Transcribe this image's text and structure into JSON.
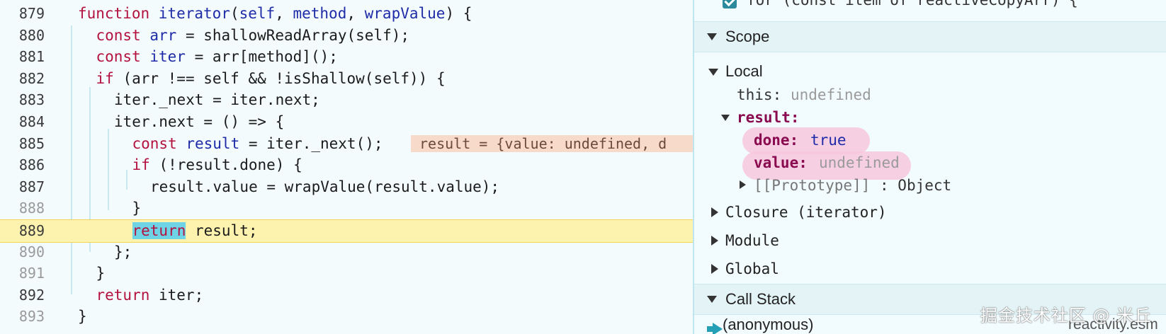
{
  "editor": {
    "lines": [
      {
        "num": "879",
        "t": [
          {
            "c": "kw",
            "v": "function "
          },
          {
            "c": "fn",
            "v": "iterator"
          },
          {
            "c": "",
            "v": "("
          },
          {
            "c": "fn",
            "v": "self"
          },
          {
            "c": "",
            "v": ", "
          },
          {
            "c": "fn",
            "v": "method"
          },
          {
            "c": "",
            "v": ", "
          },
          {
            "c": "fn",
            "v": "wrapValue"
          },
          {
            "c": "",
            "v": ") {"
          }
        ]
      },
      {
        "num": "880",
        "t": [
          {
            "c": "kw",
            "v": "const "
          },
          {
            "c": "fn",
            "v": "arr"
          },
          {
            "c": "",
            "v": " = shallowReadArray(self);"
          }
        ]
      },
      {
        "num": "881",
        "t": [
          {
            "c": "kw",
            "v": "const "
          },
          {
            "c": "fn",
            "v": "iter"
          },
          {
            "c": "",
            "v": " = arr[method]();"
          }
        ]
      },
      {
        "num": "882",
        "t": [
          {
            "c": "kw",
            "v": "if"
          },
          {
            "c": "",
            "v": " (arr !== self && !isShallow(self)) {"
          }
        ]
      },
      {
        "num": "883",
        "t": [
          {
            "c": "",
            "v": "iter._next = iter.next;"
          }
        ]
      },
      {
        "num": "884",
        "t": [
          {
            "c": "",
            "v": "iter.next = () => {"
          }
        ]
      },
      {
        "num": "885",
        "t": [
          {
            "c": "kw",
            "v": "const "
          },
          {
            "c": "fn",
            "v": "result"
          },
          {
            "c": "",
            "v": " = iter._next();"
          }
        ]
      },
      {
        "num": "886",
        "t": [
          {
            "c": "kw",
            "v": "if"
          },
          {
            "c": "",
            "v": " (!result.done) {"
          }
        ]
      },
      {
        "num": "887",
        "t": [
          {
            "c": "",
            "v": "result.value = wrapValue(result.value);"
          }
        ]
      },
      {
        "num": "888",
        "t": [
          {
            "c": "",
            "v": "}"
          }
        ]
      },
      {
        "num": "889",
        "t": [
          {
            "c": "ret",
            "v": "return"
          },
          {
            "c": "",
            "v": " result;"
          }
        ]
      },
      {
        "num": "890",
        "t": [
          {
            "c": "",
            "v": "};"
          }
        ]
      },
      {
        "num": "891",
        "t": [
          {
            "c": "",
            "v": "}"
          }
        ]
      },
      {
        "num": "892",
        "t": [
          {
            "c": "kw",
            "v": "return"
          },
          {
            "c": "",
            "v": " iter;"
          }
        ]
      },
      {
        "num": "893",
        "t": [
          {
            "c": "",
            "v": "}"
          }
        ]
      }
    ],
    "inline_value": "result = {value: undefined, d"
  },
  "panel": {
    "breakpoint_text": "for (const item of reactiveCopyArr) {",
    "scope_header": "Scope",
    "local_label": "Local",
    "this_key": "this",
    "this_value": "undefined",
    "result_key": "result",
    "done_key": "done",
    "done_value": "true",
    "value_key": "value",
    "value_value": "undefined",
    "prototype_label": "[[Prototype]]",
    "prototype_value": "Object",
    "closure_label": "Closure (iterator)",
    "module_label": "Module",
    "global_label": "Global",
    "callstack_header": "Call Stack",
    "frame_name": "(anonymous)",
    "frame_file": "reactivity.esm"
  },
  "watermark": "掘金技术社区 @ 米丘",
  "colors": {
    "keyword": "#b3123f",
    "identifier": "#1f2ca8",
    "current_line": "#fdf3ae",
    "inline_value_bg": "#f8dacb",
    "highlight_pink": "#f8c7de"
  }
}
